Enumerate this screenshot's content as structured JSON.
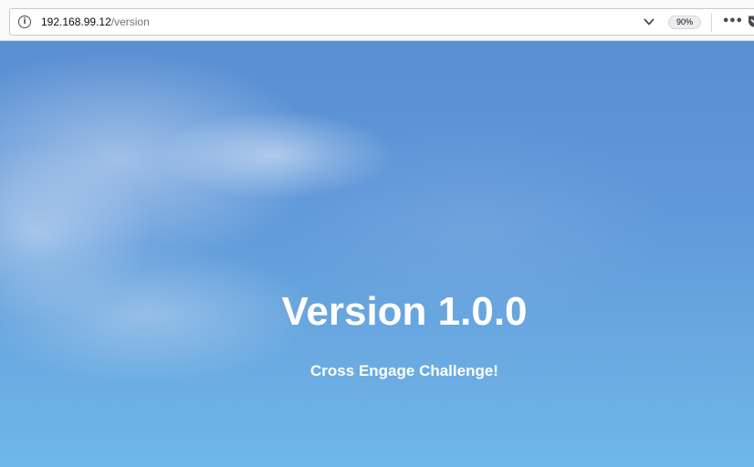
{
  "browser": {
    "url_host": "192.168.99.12",
    "url_path": "/version",
    "zoom_level": "90%",
    "icons": [
      "info-icon",
      "chevron-down-icon",
      "more-icon",
      "pocket-icon"
    ]
  },
  "page": {
    "title": "Version 1.0.0",
    "subtitle": "Cross Engage Challenge!"
  }
}
